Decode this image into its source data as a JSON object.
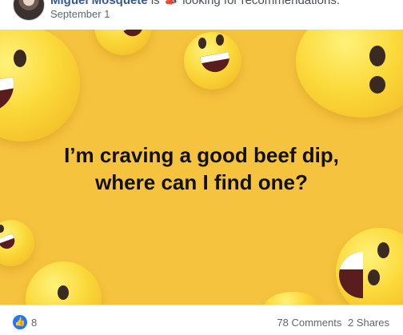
{
  "post": {
    "author": "Miguel Mosquete",
    "verb": "is",
    "activity": "looking for recommendations.",
    "date": "September 1",
    "image_text_line1": "I’m craving a good beef dip,",
    "image_text_line2": "where can I find one?"
  },
  "footer": {
    "like_count": "8",
    "comments": "78 Comments",
    "shares": "2 Shares"
  },
  "icons": {
    "reaction": "like-icon",
    "activity": "megaphone-icon"
  },
  "colors": {
    "background": "#f6c33e",
    "like": "#2078f4",
    "name": "#385898"
  }
}
